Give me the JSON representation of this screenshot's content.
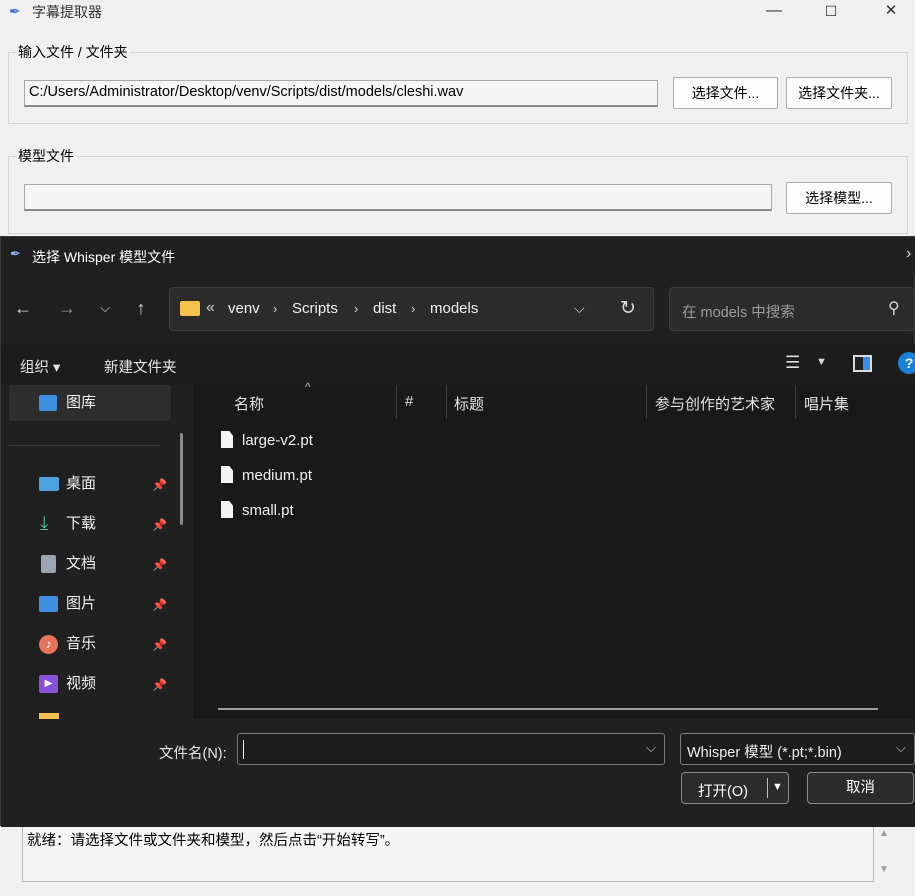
{
  "main": {
    "title": "字幕提取器",
    "window_controls": {
      "minimize": "—",
      "maximize": "☐",
      "close": "✕"
    },
    "input_group": {
      "legend": "输入文件 / 文件夹",
      "path_value": "C:/Users/Administrator/Desktop/venv/Scripts/dist/models/cleshi.wav",
      "choose_file_label": "选择文件...",
      "choose_folder_label": "选择文件夹..."
    },
    "model_group": {
      "legend": "模型文件",
      "path_value": "",
      "choose_model_label": "选择模型..."
    },
    "status_text": "就绪：请选择文件或文件夹和模型，然后点击“开始转写”。"
  },
  "dialog": {
    "title": "选择 Whisper 模型文件",
    "breadcrumb": [
      "venv",
      "Scripts",
      "dist",
      "models"
    ],
    "breadcrumb_prefix": "«",
    "search_placeholder": "在 models 中搜索",
    "toolbar": {
      "organize": "组织 ▾",
      "new_folder": "新建文件夹"
    },
    "sidebar": {
      "top": "图库",
      "items": [
        {
          "label": "桌面",
          "icon": "desktop-icon",
          "color": "#4aa3df"
        },
        {
          "label": "下载",
          "icon": "download-icon",
          "color": "#3dc9a0"
        },
        {
          "label": "文档",
          "icon": "document-icon",
          "color": "#9aa6b5"
        },
        {
          "label": "图片",
          "icon": "pictures-icon",
          "color": "#3f8fe0"
        },
        {
          "label": "音乐",
          "icon": "music-icon",
          "color": "#e5735a"
        },
        {
          "label": "视频",
          "icon": "video-icon",
          "color": "#8a4fd6"
        }
      ]
    },
    "columns": [
      "名称",
      "#",
      "标题",
      "参与创作的艺术家",
      "唱片集"
    ],
    "files": [
      "large-v2.pt",
      "medium.pt",
      "small.pt"
    ],
    "filename_label": "文件名(N):",
    "filename_value": "",
    "filetype": "Whisper 模型 (*.pt;*.bin)",
    "open_label": "打开(O)",
    "cancel_label": "取消"
  }
}
